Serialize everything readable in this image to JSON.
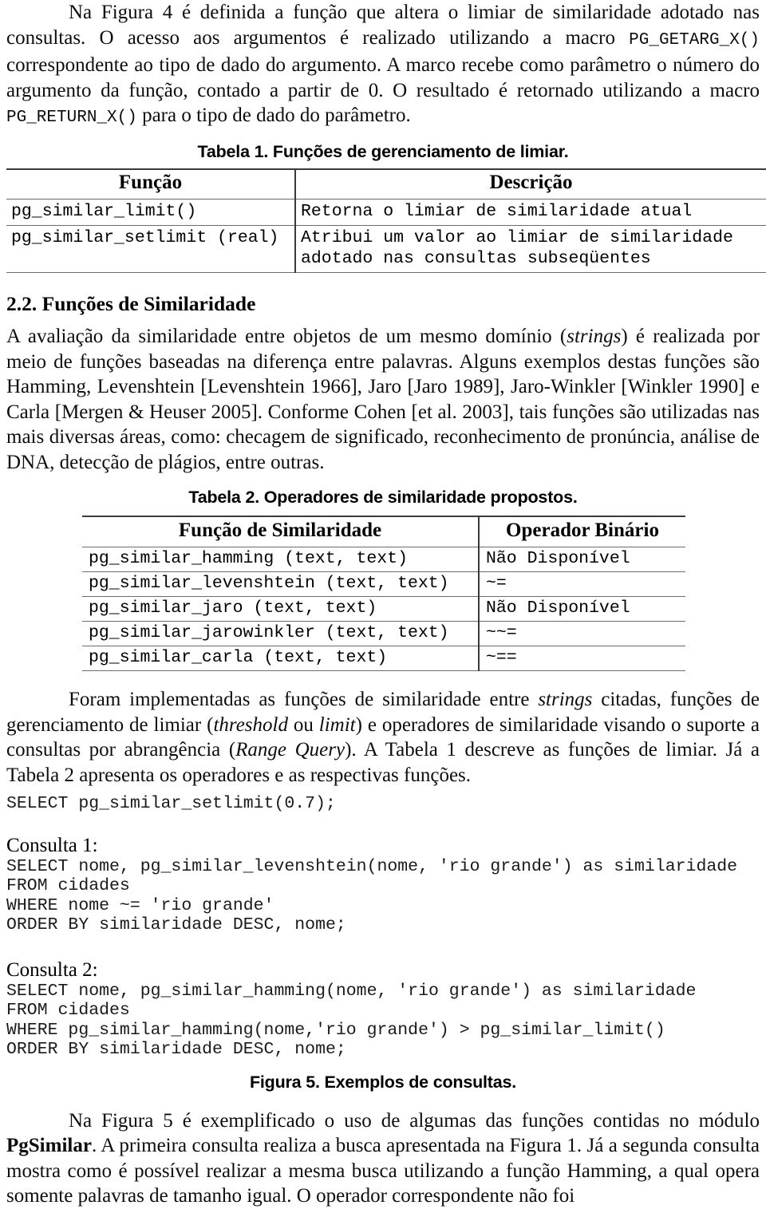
{
  "paragraphs": {
    "intro": {
      "part1": "Na Figura 4 é definida a função que altera o limiar de similaridade adotado nas consultas. O acesso aos argumentos é realizado utilizando a macro ",
      "macro1": "PG_GETARG_X()",
      "part2": " correspondente ao tipo de dado do argumento. A marco recebe como parâmetro o número do argumento da função, contado a partir de 0. O resultado é retornado utilizando a macro ",
      "macro2": "PG_RETURN_X()",
      "part3": " para o tipo de dado do parâmetro."
    },
    "similarity": {
      "p1": "A avaliação da similaridade entre objetos de um mesmo domínio (",
      "it1": "strings",
      "p2": ") é realizada por meio de funções baseadas na diferença entre palavras. Alguns exemplos destas funções são Hamming, Levenshtein [Levenshtein 1966], Jaro [Jaro 1989], Jaro-Winkler [Winkler 1990] e Carla [Mergen & Heuser 2005]. Conforme Cohen [et al. 2003], tais funções são utilizadas nas mais diversas áreas, como: checagem de significado, reconhecimento de pronúncia, análise de DNA, detecção de plágios, entre outras."
    },
    "implemented": {
      "p1": "Foram implementadas as funções de similaridade entre ",
      "it1": "strings",
      "p2": " citadas, funções de gerenciamento de limiar (",
      "it2": "threshold",
      "p3": " ou ",
      "it3": "limit",
      "p4": ") e operadores de similaridade visando o suporte a consultas por abrangência (",
      "it4": "Range Query",
      "p5": "). A Tabela 1 descreve as funções de limiar. Já a Tabela 2 apresenta os operadores e as respectivas funções."
    },
    "closing": {
      "p1": "Na Figura 5 é exemplificado o uso de algumas das funções contidas no módulo ",
      "b1": "PgSimilar",
      "p2": ". A primeira consulta realiza a busca apresentada na Figura 1. Já a segunda consulta mostra como é possível realizar a mesma busca utilizando a função Hamming, a qual opera somente palavras de tamanho igual. O operador correspondente não foi"
    }
  },
  "section": {
    "number_title": "2.2. Funções de Similaridade"
  },
  "table1": {
    "caption": "Tabela 1. Funções de gerenciamento de limiar.",
    "headers": [
      "Função",
      "Descrição"
    ],
    "rows": [
      {
        "function": "pg_similar_limit()",
        "description": "Retorna o limiar de similaridade atual"
      },
      {
        "function": "pg_similar_setlimit (real)",
        "description": "Atribui um valor ao limiar de similaridade\nadotado nas consultas subseqüentes"
      }
    ]
  },
  "table2": {
    "caption": "Tabela 2. Operadores de similaridade propostos.",
    "headers": [
      "Função de Similaridade",
      "Operador Binário"
    ],
    "rows": [
      {
        "function": "pg_similar_hamming (text, text)",
        "operator": "Não Disponível"
      },
      {
        "function": "pg_similar_levenshtein (text, text)",
        "operator": "~="
      },
      {
        "function": "pg_similar_jaro (text, text)",
        "operator": "Não Disponível"
      },
      {
        "function": "pg_similar_jarowinkler (text, text)",
        "operator": "~~="
      },
      {
        "function": "pg_similar_carla (text, text)",
        "operator": "~=="
      }
    ]
  },
  "code": {
    "setlimit": "SELECT pg_similar_setlimit(0.7);",
    "consulta1_label": "Consulta 1:",
    "consulta1": "SELECT nome, pg_similar_levenshtein(nome, 'rio grande') as similaridade\nFROM cidades\nWHERE nome ~= 'rio grande'\nORDER BY similaridade DESC, nome;",
    "consulta2_label": "Consulta 2:",
    "consulta2": "SELECT nome, pg_similar_hamming(nome, 'rio grande') as similaridade\nFROM cidades\nWHERE pg_similar_hamming(nome,'rio grande') > pg_similar_limit()\nORDER BY similaridade DESC, nome;"
  },
  "figure5": {
    "caption": "Figura 5. Exemplos de consultas."
  },
  "colors": {
    "text": "#0d0d0d",
    "rule_dark": "#3a3a3a",
    "rule_light": "#6b6b6b",
    "background": "#ffffff"
  }
}
